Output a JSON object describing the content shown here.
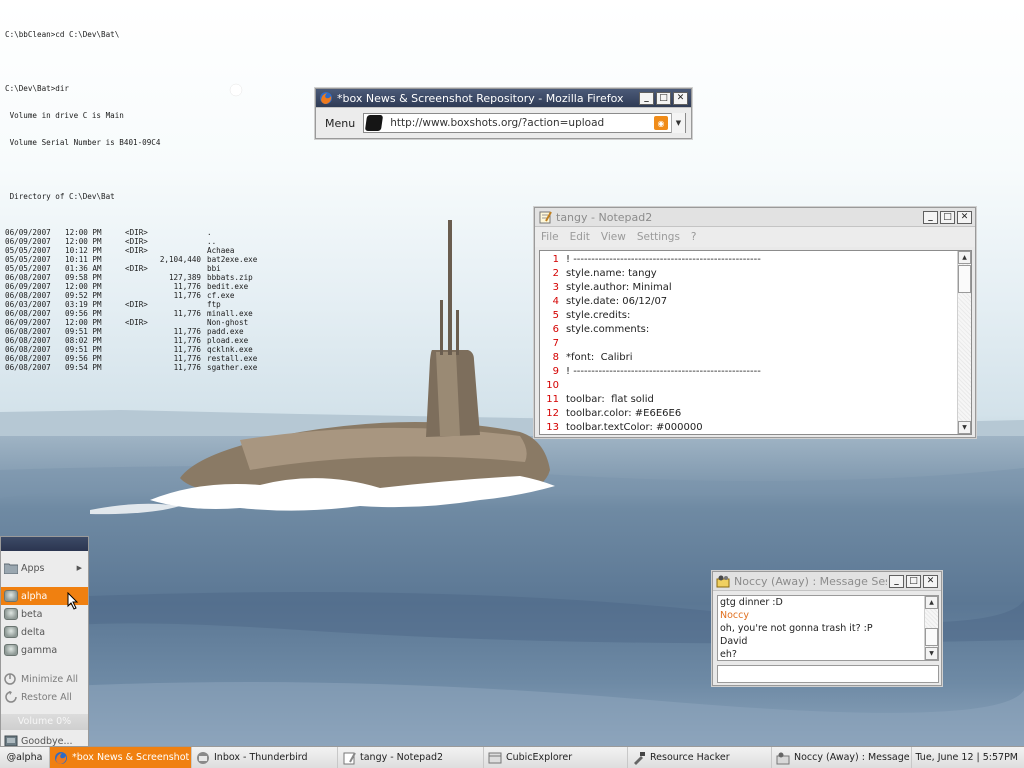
{
  "console": {
    "lines_top": [
      "C:\\bbClean>cd C:\\Dev\\Bat\\",
      "",
      "C:\\Dev\\Bat>dir",
      " Volume in drive C is Main",
      " Volume Serial Number is B401-09C4",
      "",
      " Directory of C:\\Dev\\Bat"
    ],
    "rows": [
      {
        "date": "06/09/2007",
        "time": "12:00 PM",
        "dir": "<DIR>",
        "size": "",
        "name": "."
      },
      {
        "date": "06/09/2007",
        "time": "12:00 PM",
        "dir": "<DIR>",
        "size": "",
        "name": ".."
      },
      {
        "date": "05/05/2007",
        "time": "10:12 PM",
        "dir": "<DIR>",
        "size": "",
        "name": "Achaea"
      },
      {
        "date": "05/05/2007",
        "time": "10:11 PM",
        "dir": "",
        "size": "2,104,440",
        "name": "bat2exe.exe"
      },
      {
        "date": "05/05/2007",
        "time": "01:36 AM",
        "dir": "<DIR>",
        "size": "",
        "name": "bbi"
      },
      {
        "date": "06/08/2007",
        "time": "09:58 PM",
        "dir": "",
        "size": "127,389",
        "name": "bbbats.zip"
      },
      {
        "date": "06/09/2007",
        "time": "12:00 PM",
        "dir": "",
        "size": "11,776",
        "name": "bedit.exe"
      },
      {
        "date": "06/08/2007",
        "time": "09:52 PM",
        "dir": "",
        "size": "11,776",
        "name": "cf.exe"
      },
      {
        "date": "06/03/2007",
        "time": "03:19 PM",
        "dir": "<DIR>",
        "size": "",
        "name": "ftp"
      },
      {
        "date": "06/08/2007",
        "time": "09:56 PM",
        "dir": "",
        "size": "11,776",
        "name": "minall.exe"
      },
      {
        "date": "06/09/2007",
        "time": "12:00 PM",
        "dir": "<DIR>",
        "size": "",
        "name": "Non-ghost"
      },
      {
        "date": "06/08/2007",
        "time": "09:51 PM",
        "dir": "",
        "size": "11,776",
        "name": "padd.exe"
      },
      {
        "date": "06/08/2007",
        "time": "08:02 PM",
        "dir": "",
        "size": "11,776",
        "name": "pload.exe"
      },
      {
        "date": "06/08/2007",
        "time": "09:51 PM",
        "dir": "",
        "size": "11,776",
        "name": "qcklnk.exe"
      },
      {
        "date": "06/08/2007",
        "time": "09:56 PM",
        "dir": "",
        "size": "11,776",
        "name": "restall.exe"
      },
      {
        "date": "06/08/2007",
        "time": "09:54 PM",
        "dir": "",
        "size": "11,776",
        "name": "sgather.exe"
      }
    ]
  },
  "firefox": {
    "title": "*box News & Screenshot Repository - Mozilla Firefox",
    "menu_label": "Menu",
    "url": "http://www.boxshots.org/?action=upload",
    "icons": {
      "app": "firefox-icon",
      "feed": "rss-feed-icon"
    }
  },
  "notepad": {
    "title": "tangy - Notepad2",
    "menu": [
      "File",
      "Edit",
      "View",
      "Settings",
      "?"
    ],
    "lines": [
      {
        "num": "1",
        "text": "! ----------------------------------------------------"
      },
      {
        "num": "2",
        "text": "style.name: tangy"
      },
      {
        "num": "3",
        "text": "style.author: Minimal"
      },
      {
        "num": "4",
        "text": "style.date: 06/12/07"
      },
      {
        "num": "5",
        "text": "style.credits:"
      },
      {
        "num": "6",
        "text": "style.comments:"
      },
      {
        "num": "7",
        "text": ""
      },
      {
        "num": "8",
        "text": "*font:  Calibri"
      },
      {
        "num": "9",
        "text": "! ----------------------------------------------------"
      },
      {
        "num": "10",
        "text": ""
      },
      {
        "num": "11",
        "text": "toolbar:  flat solid"
      },
      {
        "num": "12",
        "text": "toolbar.color: #E6E6E6"
      },
      {
        "num": "13",
        "text": "toolbar.textColor: #000000"
      }
    ]
  },
  "chat": {
    "title": "Noccy (Away) : Message Session",
    "messages": [
      {
        "text": "gtg dinner :D",
        "nick": false
      },
      {
        "text": "Noccy",
        "nick": true
      },
      {
        "text": "oh, you're not gonna trash it? :P",
        "nick": false
      },
      {
        "text": "David",
        "nick": false
      },
      {
        "text": "eh?",
        "nick": false
      }
    ],
    "input_value": ""
  },
  "rootmenu": {
    "apps_label": "Apps",
    "workspaces": [
      "alpha",
      "beta",
      "delta",
      "gamma"
    ],
    "selected_workspace": "alpha",
    "minimize_all": "Minimize All",
    "restore_all": "Restore All",
    "volume": "Volume 0%",
    "goodbye": "Goodbye..."
  },
  "taskbar": {
    "workspace": "@alpha",
    "tasks": [
      {
        "label": "*box News & Screenshot R...",
        "icon": "firefox-icon",
        "active": true
      },
      {
        "label": "Inbox - Thunderbird",
        "icon": "thunderbird-icon",
        "active": false
      },
      {
        "label": "tangy - Notepad2",
        "icon": "notepad-icon",
        "active": false
      },
      {
        "label": "CubicExplorer",
        "icon": "explorer-icon",
        "active": false
      },
      {
        "label": "Resource Hacker",
        "icon": "resource-hacker-icon",
        "active": false
      },
      {
        "label": "Noccy (Away) : Message S...",
        "icon": "messenger-icon",
        "active": false
      }
    ],
    "clock": "Tue, June 12  |  5:57PM"
  },
  "colors": {
    "accent": "#f08010",
    "active_title": "#2f3b55",
    "line_numbers": "#d40000",
    "nick": "#e07020"
  }
}
